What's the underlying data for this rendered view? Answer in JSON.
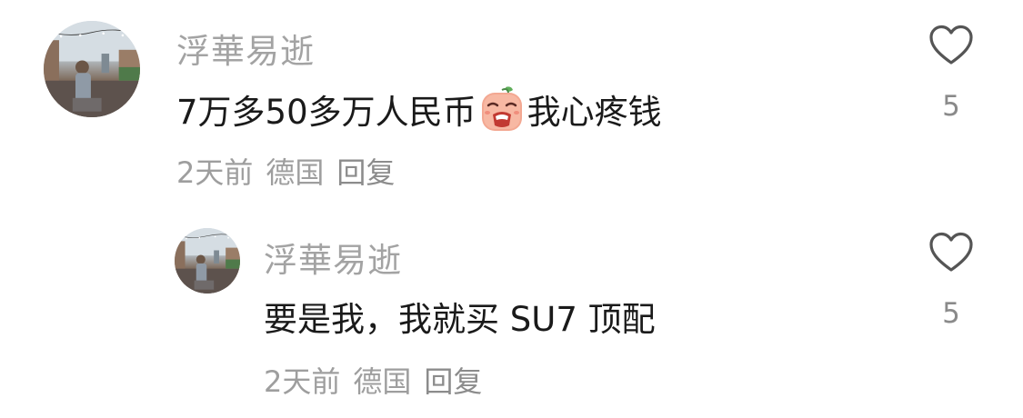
{
  "comments": [
    {
      "username": "浮華易逝",
      "text_before": "7万多50多万人民币",
      "emoji": "crying-face-emoji",
      "text_after": "我心疼钱",
      "time": "2天前",
      "location": "德国",
      "reply_label": "回复",
      "likes": "5"
    },
    {
      "username": "浮華易逝",
      "text": "要是我，我就买 SU7 顶配",
      "time": "2天前",
      "location": "德国",
      "reply_label": "回复",
      "likes": "5"
    }
  ],
  "icons": {
    "like": "heart-outline-icon"
  },
  "colors": {
    "username": "#a3a3a3",
    "text": "#1a1a1a",
    "meta": "#9e9e9e",
    "icon": "#555555"
  }
}
